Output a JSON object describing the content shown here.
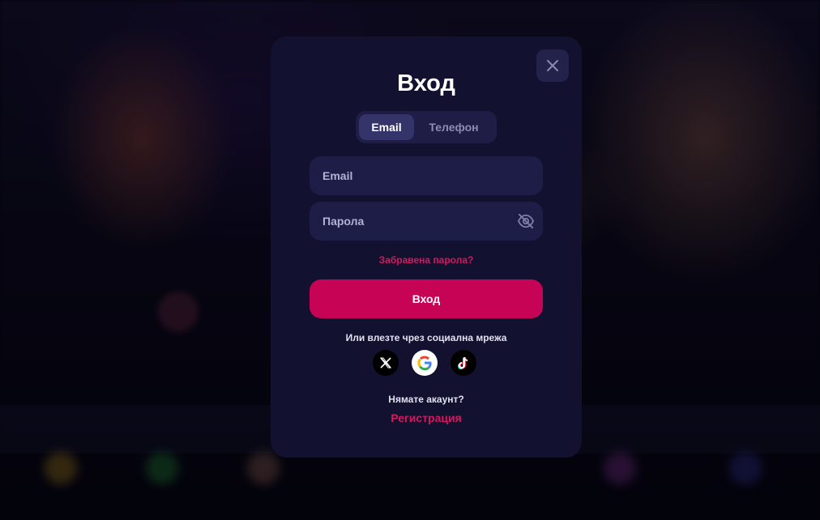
{
  "modal": {
    "title": "Вход",
    "tabs": [
      {
        "label": "Email",
        "active": true
      },
      {
        "label": "Телефон",
        "active": false
      }
    ],
    "email_field": {
      "placeholder": "Email",
      "value": ""
    },
    "password_field": {
      "placeholder": "Парола",
      "value": ""
    },
    "forgot_password": "Забравена парола?",
    "login_button": "Вход",
    "social_login_text": "Или влезте чрез социална мрежа",
    "social_icons": [
      "x-icon",
      "google-icon",
      "tiktok-icon"
    ],
    "no_account_text": "Нямате акаунт?",
    "register_link": "Регистрация"
  },
  "colors": {
    "modal_bg": "#121130",
    "input_bg": "#1e1d48",
    "accent": "#c60354",
    "link": "#d6185e"
  }
}
